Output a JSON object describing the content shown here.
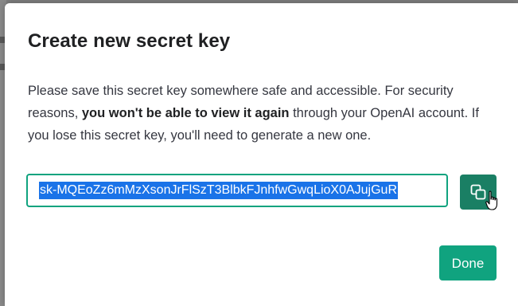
{
  "dialog": {
    "title": "Create new secret key",
    "description_part1": "Please save this secret key somewhere safe and accessible. For security reasons, ",
    "description_bold": "you won't be able to view it again",
    "description_part2": " through your OpenAI account. If you lose this secret key, you'll need to generate a new one.",
    "secret_key_value": "sk-MQEoZz6mMzXsonJrFlSzT3BlbkFJnhfwGwqLioX0AJujGuR",
    "copy_icon": "copy-icon",
    "done_label": "Done"
  },
  "colors": {
    "accent": "#10a37f",
    "accent_dark": "#1a7f64",
    "selection": "#1a73e8",
    "title": "#202123",
    "text": "#353740"
  }
}
